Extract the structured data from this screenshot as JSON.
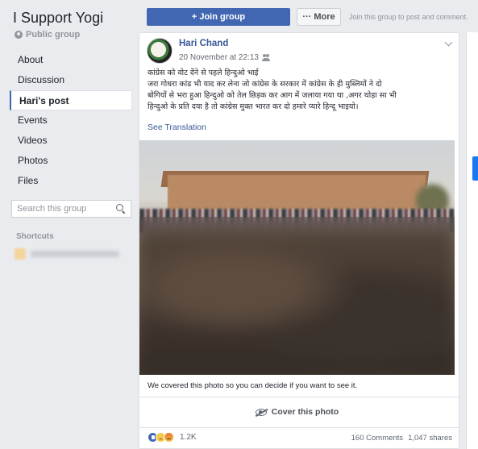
{
  "sidebar": {
    "group_name": "I Support Yogi",
    "privacy": "Public group",
    "nav": [
      "About",
      "Discussion",
      "Hari's post",
      "Events",
      "Videos",
      "Photos",
      "Files"
    ],
    "active_index": 2,
    "search_placeholder": "Search this group",
    "shortcuts_label": "Shortcuts"
  },
  "topbar": {
    "join_label": "+ Join group",
    "more_label": "··· More",
    "hint": "Join this group to post and comment."
  },
  "post": {
    "author": "Hari Chand",
    "timestamp": "20 November at 22:13",
    "text_lines": [
      "कांग्रेस को वोट देंने से पहले हिन्दुओ भाई",
      "जरा गोधरा कांड भी याद कर लेना जो कांग्रेस के सरकार में कांग्रेस के ही मुस्लिमों ने दो",
      "बोगियों से भरा हुआ हिन्दुओ को तेल छिड़क कर आग में जलाया गया था ,अगर थोड़ा सा भी",
      "हिन्दुओ के प्रति दया है तो कांग्रेस मुक्त भारत कर दो हमारे प्यारे हिन्दू भाइयो।"
    ],
    "see_translation": "See Translation",
    "cover_note": "We covered this photo so you can decide if you want to see it.",
    "cover_button": "Cover this photo",
    "reaction_count": "1.2K",
    "comments": "160 Comments",
    "shares": "1,047 shares"
  }
}
